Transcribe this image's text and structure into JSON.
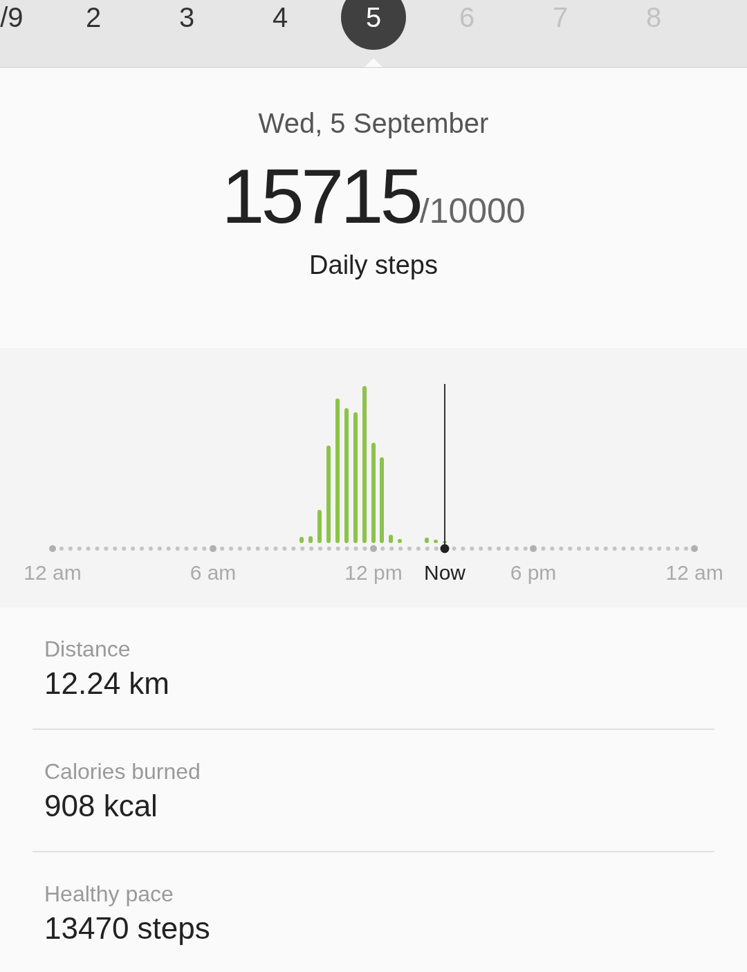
{
  "date_strip": [
    {
      "label": "/9",
      "selected": false,
      "disabled": false
    },
    {
      "label": "2",
      "selected": false,
      "disabled": false
    },
    {
      "label": "3",
      "selected": false,
      "disabled": false
    },
    {
      "label": "4",
      "selected": false,
      "disabled": false
    },
    {
      "label": "5",
      "selected": true,
      "disabled": false
    },
    {
      "label": "6",
      "selected": false,
      "disabled": true
    },
    {
      "label": "7",
      "selected": false,
      "disabled": true
    },
    {
      "label": "8",
      "selected": false,
      "disabled": true
    }
  ],
  "summary": {
    "date": "Wed, 5 September",
    "steps": "15715",
    "goal": "/10000",
    "caption": "Daily steps"
  },
  "timeline": {
    "axis_labels": [
      {
        "text": "12 am",
        "current": false
      },
      {
        "text": "6 am",
        "current": false
      },
      {
        "text": "12 pm",
        "current": false
      },
      {
        "text": "Now",
        "current": true
      },
      {
        "text": "6 pm",
        "current": false
      },
      {
        "text": "12 am",
        "current": false
      }
    ]
  },
  "stats": [
    {
      "label": "Distance",
      "value": "12.24 km"
    },
    {
      "label": "Calories burned",
      "value": "908 kcal"
    },
    {
      "label": "Healthy pace",
      "value": "13470 steps"
    }
  ]
}
